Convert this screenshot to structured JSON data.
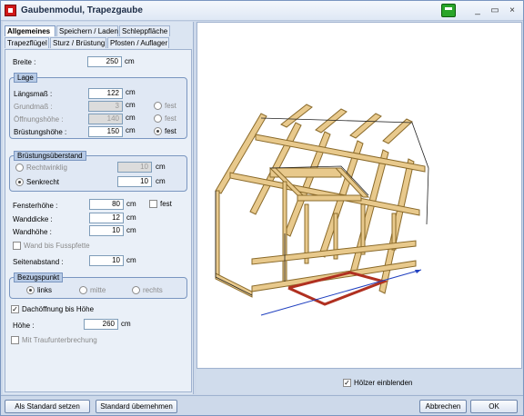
{
  "window": {
    "title": "Gaubenmodul, Trapezgaube",
    "controls": [
      "_",
      "▭",
      "×"
    ]
  },
  "tabs_row1": [
    "Allgemeines",
    "Speichern / Laden",
    "Schleppfläche"
  ],
  "tabs_row2": [
    "Trapezflügel",
    "Sturz / Brüstung",
    "Pfosten / Auflager"
  ],
  "form": {
    "breite": {
      "label": "Breite :",
      "value": "250",
      "unit": "cm"
    },
    "lage": {
      "title": "Lage",
      "rows": [
        {
          "label": "Längsmaß :",
          "value": "122",
          "unit": "cm",
          "radio": "",
          "disabled": false
        },
        {
          "label": "Grundmaß :",
          "value": "3",
          "unit": "cm",
          "radio": "fest",
          "disabled": true
        },
        {
          "label": "Öffnungshöhe :",
          "value": "140",
          "unit": "cm",
          "radio": "fest",
          "disabled": true
        },
        {
          "label": "Brüstungshöhe :",
          "value": "150",
          "unit": "cm",
          "radio": "fest",
          "disabled": false
        }
      ]
    },
    "bruestung": {
      "title": "Brüstungsüberstand",
      "rechtwinklig": {
        "label": "Rechtwinklig",
        "value": "10",
        "unit": "cm"
      },
      "senkrecht": {
        "label": "Senkrecht",
        "value": "10",
        "unit": "cm"
      }
    },
    "fensterhoehe": {
      "label": "Fensterhöhe :",
      "value": "80",
      "unit": "cm",
      "check": "fest"
    },
    "wanddicke": {
      "label": "Wanddicke :",
      "value": "12",
      "unit": "cm"
    },
    "wandhoehe": {
      "label": "Wandhöhe :",
      "value": "10",
      "unit": "cm"
    },
    "wand_fusspfette": "Wand bis Fusspfette",
    "seitenabstand": {
      "label": "Seitenabstand :",
      "value": "10",
      "unit": "cm"
    },
    "bezugspunkt": {
      "title": "Bezugspunkt",
      "options": [
        "links",
        "mitte",
        "rechts"
      ]
    },
    "dachoeffnung": "Dachöffnung bis Höhe",
    "hoehe": {
      "label": "Höhe :",
      "value": "260",
      "unit": "cm"
    },
    "traufunterbrechung": "Mit Traufunterbrechung"
  },
  "hoelzer_label": "Hölzer einblenden",
  "buttons": {
    "als_standard": "Als Standard setzen",
    "standard_uebernehmen": "Standard übernehmen",
    "abbrechen": "Abbrechen",
    "ok": "OK"
  },
  "colors": {
    "wood": "#e8c98c",
    "wood_edge": "#8a6a2a",
    "accent_red": "#b03020",
    "axis_blue": "#2040c0"
  }
}
